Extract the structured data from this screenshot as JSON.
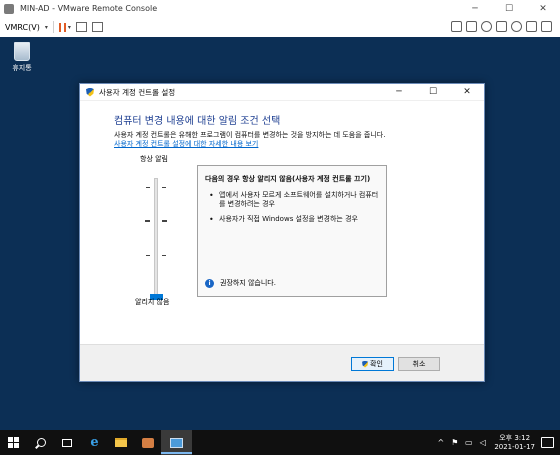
{
  "vm": {
    "title": "MIN-AD - VMware Remote Console",
    "menu_label": "VMRC(V)",
    "menu_caret": "▾",
    "controls": [
      "─",
      "☐",
      "✕"
    ]
  },
  "desktop": {
    "recycle_label": "휴지통"
  },
  "dialog": {
    "title": "사용자 계정 컨트롤 설정",
    "controls": [
      "─",
      "☐",
      "✕"
    ],
    "heading": "컴퓨터 변경 내용에 대한 알림 조건 선택",
    "description": "사용자 계정 컨트롤은 유해한 프로그램이 컴퓨터를 변경하는 것을 방지하는 데 도움을 줍니다.",
    "link": "사용자 계정 컨트롤 설정에 대한 자세한 내용 보기",
    "slider": {
      "top_label": "항상 알림",
      "bottom_label": "알리지 않음",
      "level": 0
    },
    "panel": {
      "heading": "다음의 경우 항상 알리지 않음(사용자 계정 컨트롤 끄기)",
      "bullets": [
        "앱에서 사용자 모르게 소프트웨어를 설치하거나 컴퓨터를 변경하려는 경우",
        "사용자가 직접 Windows 설정을 변경하는 경우"
      ],
      "recommendation": "권장하지 않습니다."
    },
    "ok_label": "확인",
    "cancel_label": "취소"
  },
  "taskbar": {
    "time": "오후 3:12",
    "date": "2021-01-17",
    "tray_chevron": "^"
  }
}
